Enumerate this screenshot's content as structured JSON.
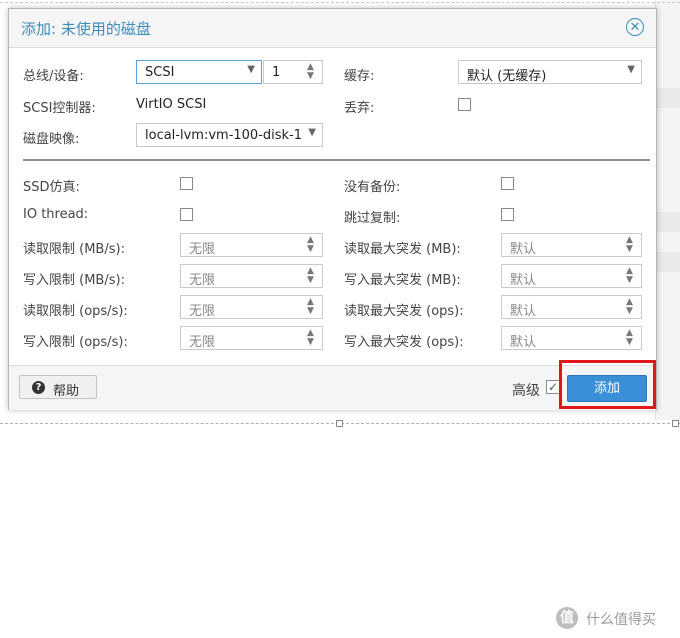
{
  "dialog": {
    "title": "添加: 未使用的磁盘",
    "close_glyph": "✕"
  },
  "left": {
    "bus_label": "总线/设备:",
    "bus_value": "SCSI",
    "device_value": "1",
    "controller_label": "SCSI控制器:",
    "controller_value": "VirtIO SCSI",
    "disk_label": "磁盘映像:",
    "disk_value": "local-lvm:vm-100-disk-1"
  },
  "right": {
    "cache_label": "缓存:",
    "cache_value": "默认 (无缓存)",
    "discard_label": "丢弃:"
  },
  "advanced": {
    "ssd_label": "SSD仿真:",
    "io_label": "IO thread:",
    "read_mb_label": "读取限制 (MB/s):",
    "read_mb_value": "无限",
    "write_mb_label": "写入限制 (MB/s):",
    "write_mb_value": "无限",
    "read_ops_label": "读取限制 (ops/s):",
    "read_ops_value": "无限",
    "write_ops_label": "写入限制 (ops/s):",
    "write_ops_value": "无限",
    "no_backup_label": "没有备份:",
    "skip_repl_label": "跳过复制:",
    "read_burst_mb_label": "读取最大突发 (MB):",
    "read_burst_mb_value": "默认",
    "write_burst_mb_label": "写入最大突发 (MB):",
    "write_burst_mb_value": "默认",
    "read_burst_ops_label": "读取最大突发 (ops):",
    "read_burst_ops_value": "默认",
    "write_burst_ops_label": "写入最大突发 (ops):",
    "write_burst_ops_value": "默认"
  },
  "footer": {
    "help_icon": "?",
    "help_label": "帮助",
    "advanced_label": "高级",
    "advanced_check": "✓",
    "add_label": "添加"
  },
  "watermark": {
    "icon": "值",
    "text": "什么值得买"
  },
  "colors": {
    "accent": "#3c8dbc",
    "primary_button": "#3b8fd6",
    "highlight_box": "#e0161b"
  }
}
